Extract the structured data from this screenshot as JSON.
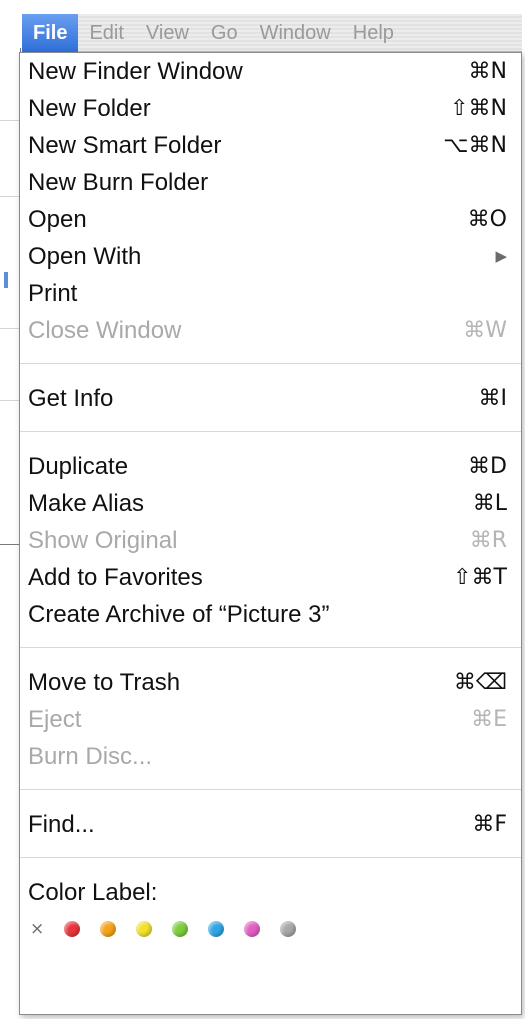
{
  "menubar": {
    "items": [
      {
        "label": "File",
        "active": true
      },
      {
        "label": "Edit",
        "active": false
      },
      {
        "label": "View",
        "active": false
      },
      {
        "label": "Go",
        "active": false
      },
      {
        "label": "Window",
        "active": false
      },
      {
        "label": "Help",
        "active": false
      }
    ]
  },
  "file_menu": {
    "groups": [
      [
        {
          "label": "New Finder Window",
          "shortcut": "⌘N",
          "enabled": true
        },
        {
          "label": "New Folder",
          "shortcut": "⇧⌘N",
          "enabled": true
        },
        {
          "label": "New Smart Folder",
          "shortcut": "⌥⌘N",
          "enabled": true
        },
        {
          "label": "New Burn Folder",
          "shortcut": "",
          "enabled": true
        },
        {
          "label": "Open",
          "shortcut": "⌘O",
          "enabled": true
        },
        {
          "label": "Open With",
          "shortcut": "",
          "submenu": true,
          "enabled": true
        },
        {
          "label": "Print",
          "shortcut": "",
          "enabled": true
        },
        {
          "label": "Close Window",
          "shortcut": "⌘W",
          "enabled": false
        }
      ],
      [
        {
          "label": "Get Info",
          "shortcut": "⌘I",
          "enabled": true
        }
      ],
      [
        {
          "label": "Duplicate",
          "shortcut": "⌘D",
          "enabled": true
        },
        {
          "label": "Make Alias",
          "shortcut": "⌘L",
          "enabled": true
        },
        {
          "label": "Show Original",
          "shortcut": "⌘R",
          "enabled": false
        },
        {
          "label": "Add to Favorites",
          "shortcut": "⇧⌘T",
          "enabled": true
        },
        {
          "label": "Create Archive of “Picture 3”",
          "shortcut": "",
          "enabled": true
        }
      ],
      [
        {
          "label": "Move to Trash",
          "shortcut": "⌘⌫",
          "enabled": true
        },
        {
          "label": "Eject",
          "shortcut": "⌘E",
          "enabled": false
        },
        {
          "label": "Burn Disc...",
          "shortcut": "",
          "enabled": false
        }
      ],
      [
        {
          "label": "Find...",
          "shortcut": "⌘F",
          "enabled": true
        }
      ]
    ],
    "color_label": {
      "title": "Color Label:",
      "none_symbol": "×",
      "colors": [
        {
          "name": "red",
          "hex": "#e8343c"
        },
        {
          "name": "orange",
          "hex": "#f5a31c"
        },
        {
          "name": "yellow",
          "hex": "#f2e12a"
        },
        {
          "name": "green",
          "hex": "#7ccc3c"
        },
        {
          "name": "blue",
          "hex": "#2ea6e6"
        },
        {
          "name": "purple",
          "hex": "#e25ec4"
        },
        {
          "name": "gray",
          "hex": "#a8a8a8"
        }
      ]
    }
  }
}
